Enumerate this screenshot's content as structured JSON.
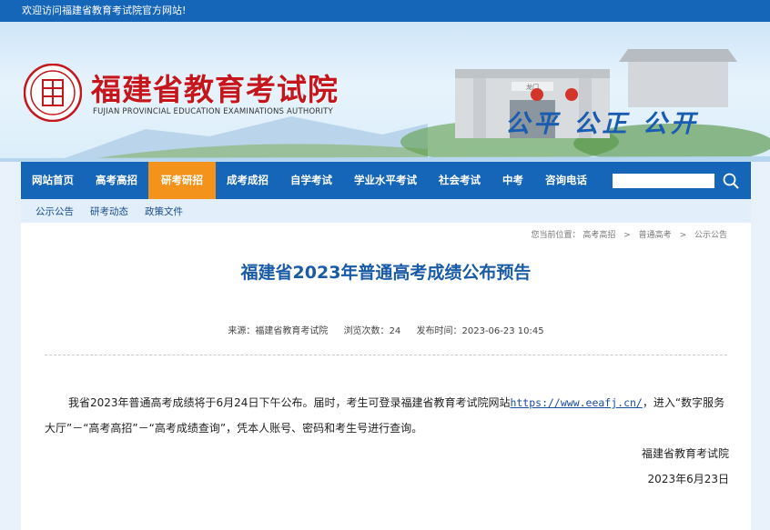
{
  "topbar": {
    "welcome": "欢迎访问福建省教育考试院官方网站!"
  },
  "header": {
    "title": "福建省教育考试院",
    "subtitle": "FUJIAN PROVINCIAL EDUCATION EXAMINATIONS AUTHORITY",
    "slogan": "公平 公正 公开",
    "logo_icon": "exam-authority-seal-icon",
    "gate_plaque": "龙门"
  },
  "nav": {
    "items": [
      {
        "label": "网站首页"
      },
      {
        "label": "高考高招"
      },
      {
        "label": "研考研招",
        "active": true
      },
      {
        "label": "成考成招"
      },
      {
        "label": "自学考试"
      },
      {
        "label": "学业水平考试"
      },
      {
        "label": "社会考试"
      },
      {
        "label": "中考"
      },
      {
        "label": "咨询电话"
      }
    ],
    "search_value": "",
    "search_icon": "search-icon",
    "active_color": "#f3931b",
    "bar_color": "#1565b8"
  },
  "subnav": {
    "items": [
      {
        "label": "公示公告"
      },
      {
        "label": "研考动态"
      },
      {
        "label": "政策文件"
      }
    ]
  },
  "breadcrumb": {
    "prefix": "您当前位置：",
    "items": [
      {
        "label": "高考高招"
      },
      {
        "label": "普通高考"
      },
      {
        "label": "公示公告"
      }
    ]
  },
  "article": {
    "title": "福建省2023年普通高考成绩公布预告",
    "source_label": "来源：",
    "source": "福建省教育考试院",
    "views_label": "浏览次数：",
    "views": "24",
    "time_label": "发布时间：",
    "time": "2023-06-23 10:45",
    "para1_before": "我省2023年普通高考成绩将于6月24日下午公布。届时，考生可登录福建省教育考试院网站",
    "link": "https://www.eeafj.cn/",
    "para1_after": "，进入“数字服务大厅”－“高考高招”－“高考成绩查询”，凭本人账号、密码和考生号进行查询。",
    "signature": "福建省教育考试院",
    "date": "2023年6月23日"
  }
}
